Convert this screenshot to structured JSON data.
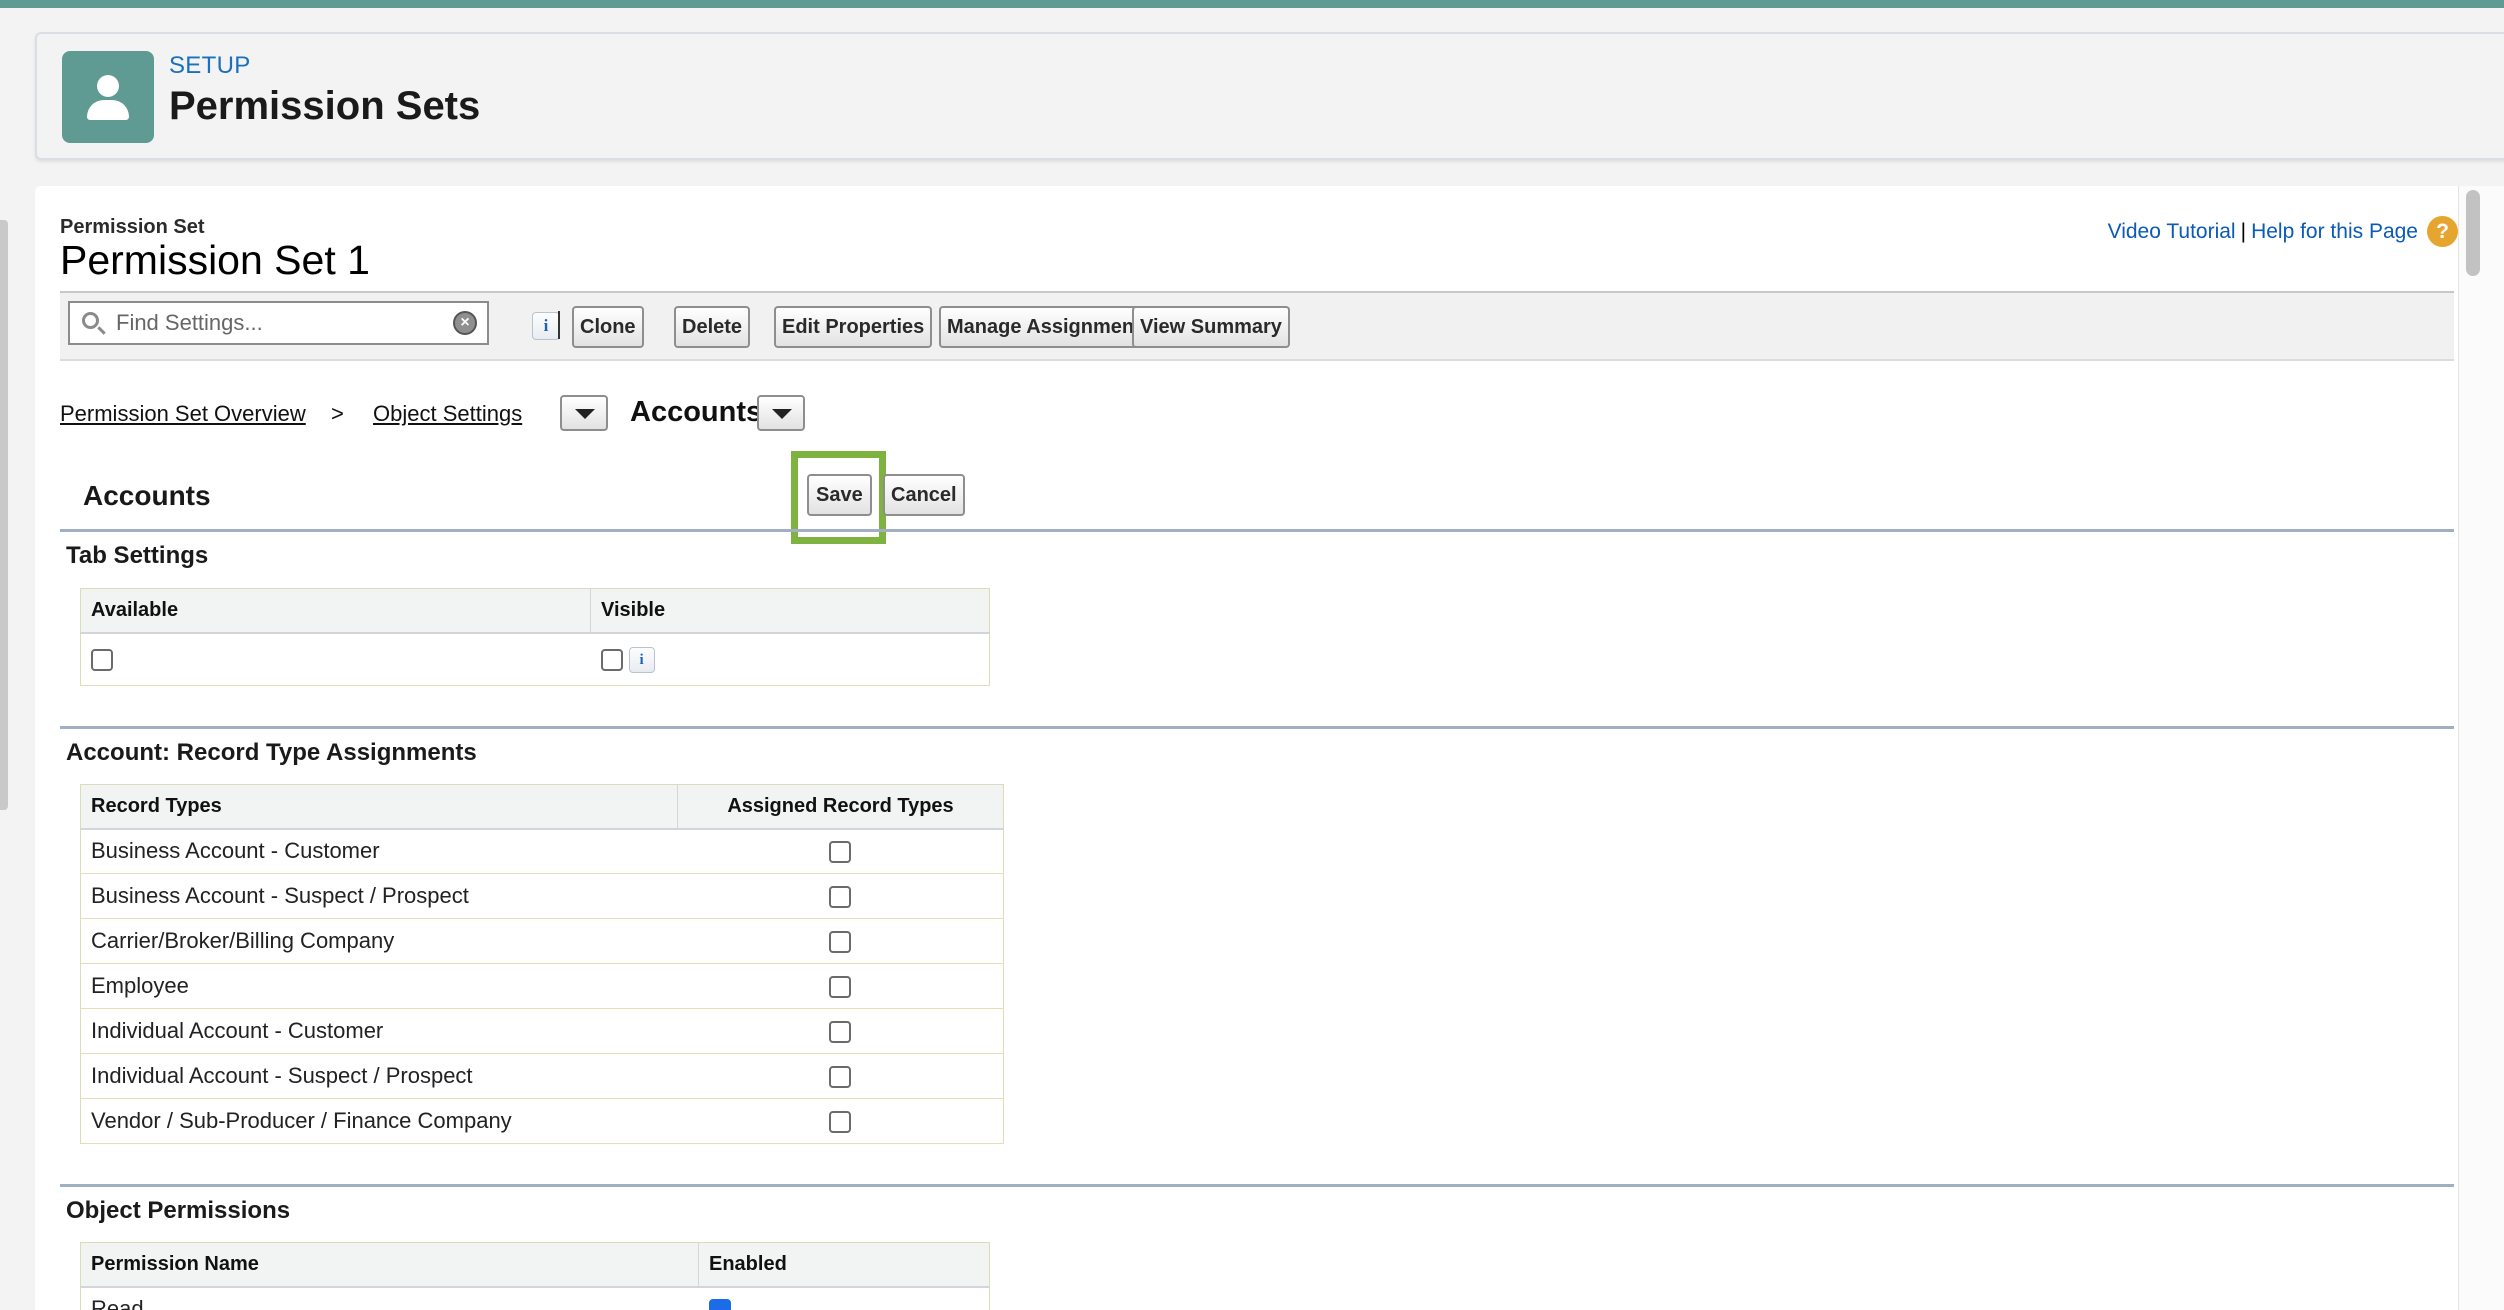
{
  "header": {
    "eyebrow": "SETUP",
    "title": "Permission Sets",
    "icon": "user-icon"
  },
  "permission_set": {
    "eyebrow": "Permission Set",
    "title": "Permission Set 1"
  },
  "help": {
    "video_tutorial": "Video Tutorial",
    "separator": "|",
    "help_page": "Help for this Page",
    "icon": "help-question-icon"
  },
  "toolbar": {
    "search_placeholder": "Find Settings...",
    "buttons": [
      "Clone",
      "Delete",
      "Edit Properties",
      "Manage Assignments",
      "View Summary"
    ]
  },
  "breadcrumb": {
    "overview": "Permission Set Overview",
    "arrow": ">",
    "object_settings": "Object Settings",
    "current": "Accounts"
  },
  "section": {
    "title": "Accounts",
    "save_label": "Save",
    "cancel_label": "Cancel"
  },
  "tab_settings": {
    "title": "Tab Settings",
    "col_available": "Available",
    "col_visible": "Visible",
    "available_checked": false,
    "visible_checked": false
  },
  "record_types": {
    "title": "Account: Record Type Assignments",
    "col_record_types": "Record Types",
    "col_assigned": "Assigned Record Types",
    "rows": [
      {
        "name": "Business Account - Customer",
        "assigned": false
      },
      {
        "name": "Business Account - Suspect / Prospect",
        "assigned": false
      },
      {
        "name": "Carrier/Broker/Billing Company",
        "assigned": false
      },
      {
        "name": "Employee",
        "assigned": false
      },
      {
        "name": "Individual Account - Customer",
        "assigned": false
      },
      {
        "name": "Individual Account - Suspect / Prospect",
        "assigned": false
      },
      {
        "name": "Vendor / Sub-Producer / Finance Company",
        "assigned": false
      }
    ]
  },
  "object_permissions": {
    "title": "Object Permissions",
    "col_name": "Permission Name",
    "col_enabled": "Enabled",
    "rows": [
      {
        "name": "Read",
        "enabled": true
      }
    ]
  },
  "colors": {
    "brand": "#5f9b93",
    "link": "#0a5ab8",
    "focus_highlight": "#7fb341"
  }
}
